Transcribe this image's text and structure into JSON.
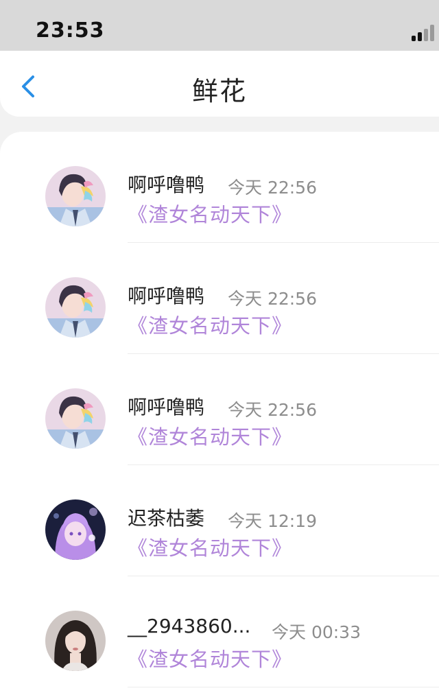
{
  "status_bar": {
    "time": "23:53"
  },
  "nav": {
    "back_icon": "chevron-left-icon",
    "title": "鲜花"
  },
  "colors": {
    "accent_blue": "#2a8fe6",
    "gift_purple": "#b085d9",
    "time_gray": "#8d8d8d"
  },
  "items": [
    {
      "name": "啊呼噜鸭",
      "time": "今天 22:56",
      "gift": "《渣女名动天下》",
      "avatar": "anime-boy-avatar"
    },
    {
      "name": "啊呼噜鸭",
      "time": "今天 22:56",
      "gift": "《渣女名动天下》",
      "avatar": "anime-boy-avatar"
    },
    {
      "name": "啊呼噜鸭",
      "time": "今天 22:56",
      "gift": "《渣女名动天下》",
      "avatar": "anime-boy-avatar"
    },
    {
      "name": "迟茶枯萎",
      "time": "今天 12:19",
      "gift": "《渣女名动天下》",
      "avatar": "anime-girl-avatar"
    },
    {
      "name": "__2943860...",
      "time": "今天 00:33",
      "gift": "《渣女名动天下》",
      "avatar": "photo-girl-avatar"
    }
  ]
}
